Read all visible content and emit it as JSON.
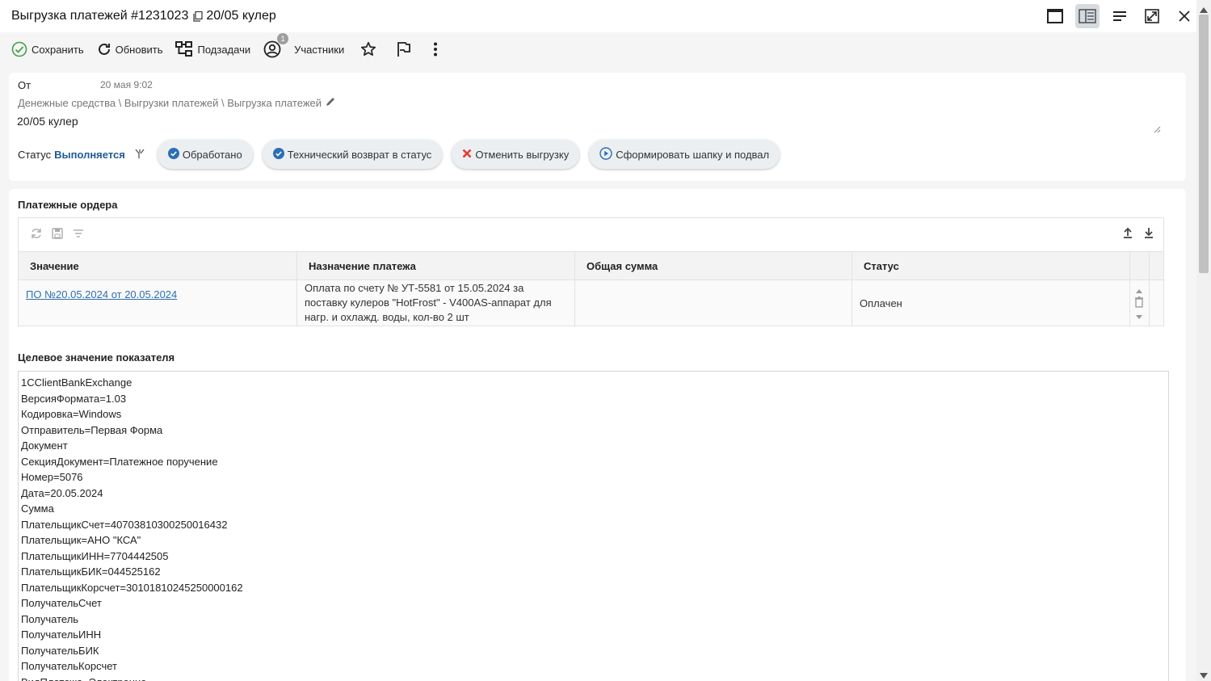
{
  "title": {
    "main": "Выгрузка платежей #1231023",
    "subject": "20/05 кулер"
  },
  "toolbar": {
    "save": "Сохранить",
    "refresh": "Обновить",
    "subtasks": "Подзадачи",
    "participants": "Участники",
    "participants_count": "1"
  },
  "header": {
    "from_label": "От",
    "from_date": "20 мая 9:02",
    "breadcrumb": "Денежные средства \\ Выгрузки платежей \\ Выгрузка платежей",
    "subject": "20/05 кулер",
    "status_label": "Статус",
    "status_value": "Выполняется"
  },
  "actions": [
    {
      "label": "Обработано",
      "icon": "check-circle-icon",
      "color": "#2d6fb4"
    },
    {
      "label": "Технический возврат в статус",
      "icon": "check-circle-icon",
      "color": "#2d6fb4"
    },
    {
      "label": "Отменить выгрузку",
      "icon": "cross-icon",
      "color": "#e53935"
    },
    {
      "label": "Сформировать шапку и подвал",
      "icon": "play-circle-icon",
      "color": "#2d6fb4"
    }
  ],
  "orders": {
    "title": "Платежные ордера",
    "columns": [
      "Значение",
      "Назначение платежа",
      "Общая сумма",
      "Статус"
    ],
    "rows": [
      {
        "value": "ПО №20.05.2024 от 20.05.2024",
        "purpose": "Оплата по счету № УТ-5581 от 15.05.2024 за поставку кулеров \"HotFrost\" - V400AS-аппарат для нагр. и охлажд. воды, кол-во 2 шт",
        "amount": "",
        "status": "Оплачен"
      }
    ]
  },
  "target": {
    "title": "Целевое значение показателя",
    "lines": [
      "1CClientBankExchange",
      "ВерсияФормата=1.03",
      "Кодировка=Windows",
      "Отправитель=Первая Форма",
      "Документ",
      "СекцияДокумент=Платежное поручение",
      "Номер=5076",
      "Дата=20.05.2024",
      "Сумма",
      "ПлательщикСчет=40703810300250016432",
      "Плательщик=АНО \"КСА\"",
      "ПлательщикИНН=7704442505",
      "ПлательщикБИК=044525162",
      "ПлательщикКорсчет=30101810245250000162",
      "ПолучательСчет",
      "Получатель",
      "ПолучательИНН",
      "ПолучательБИК",
      "ПолучательКорсчет",
      "ВидПлатежа=Электронно"
    ]
  },
  "colors": {
    "accent": "#2d6fb4",
    "status": "#1e5b94",
    "success": "#43a047",
    "danger": "#e53935"
  }
}
